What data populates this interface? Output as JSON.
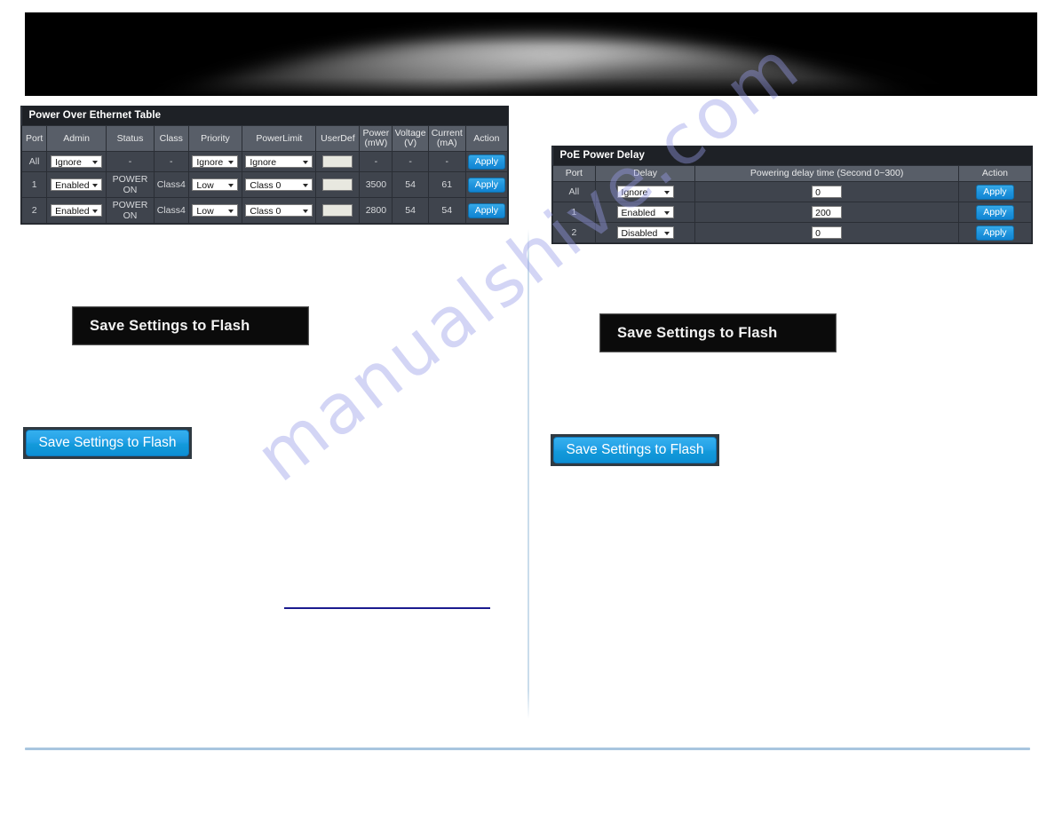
{
  "banner": {
    "alt": "dark-abstract-header-image"
  },
  "watermark": {
    "text": "manualshive.com"
  },
  "poe_table": {
    "title": "Power Over Ethernet Table",
    "columns": [
      "Port",
      "Admin",
      "Status",
      "Class",
      "Priority",
      "PowerLimit",
      "UserDef",
      "Power (mW)",
      "Voltage (V)",
      "Current (mA)",
      "Action"
    ],
    "columns_multiline": [
      {
        "line1": "Port",
        "line2": ""
      },
      {
        "line1": "Admin",
        "line2": ""
      },
      {
        "line1": "Status",
        "line2": ""
      },
      {
        "line1": "Class",
        "line2": ""
      },
      {
        "line1": "Priority",
        "line2": ""
      },
      {
        "line1": "PowerLimit",
        "line2": ""
      },
      {
        "line1": "UserDef",
        "line2": ""
      },
      {
        "line1": "Power",
        "line2": "(mW)"
      },
      {
        "line1": "Voltage",
        "line2": "(V)"
      },
      {
        "line1": "Current",
        "line2": "(mA)"
      },
      {
        "line1": "Action",
        "line2": ""
      }
    ],
    "rows": [
      {
        "port": "All",
        "admin": "Ignore",
        "status": "-",
        "class": "-",
        "priority": "Ignore",
        "power_limit": "Ignore",
        "user_def": "",
        "power_mw": "-",
        "voltage_v": "-",
        "current_ma": "-",
        "action": "Apply"
      },
      {
        "port": "1",
        "admin": "Enabled",
        "status": "POWER ON",
        "class": "Class4",
        "priority": "Low",
        "power_limit": "Class 0",
        "user_def": "",
        "power_mw": "3500",
        "voltage_v": "54",
        "current_ma": "61",
        "action": "Apply"
      },
      {
        "port": "2",
        "admin": "Enabled",
        "status": "POWER ON",
        "class": "Class4",
        "priority": "Low",
        "power_limit": "Class 0",
        "user_def": "",
        "power_mw": "2800",
        "voltage_v": "54",
        "current_ma": "54",
        "action": "Apply"
      }
    ]
  },
  "poe_delay_table": {
    "title": "PoE Power Delay",
    "columns": [
      "Port",
      "Delay",
      "Powering delay time (Second 0~300)",
      "Action"
    ],
    "rows": [
      {
        "port": "All",
        "delay": "Ignore",
        "delay_time": "0",
        "action": "Apply"
      },
      {
        "port": "1",
        "delay": "Enabled",
        "delay_time": "200",
        "action": "Apply"
      },
      {
        "port": "2",
        "delay": "Disabled",
        "delay_time": "0",
        "action": "Apply"
      }
    ]
  },
  "buttons": {
    "save_flash_label": "Save Settings to Flash"
  },
  "colors": {
    "accent_blue": "#1f9ae0",
    "table_header": "#585e68",
    "table_body": "#3f444d",
    "table_title": "#1e2126",
    "footer_rule": "#a8c6df",
    "blue_rule": "#1b1b8f",
    "watermark": "#969be8"
  }
}
